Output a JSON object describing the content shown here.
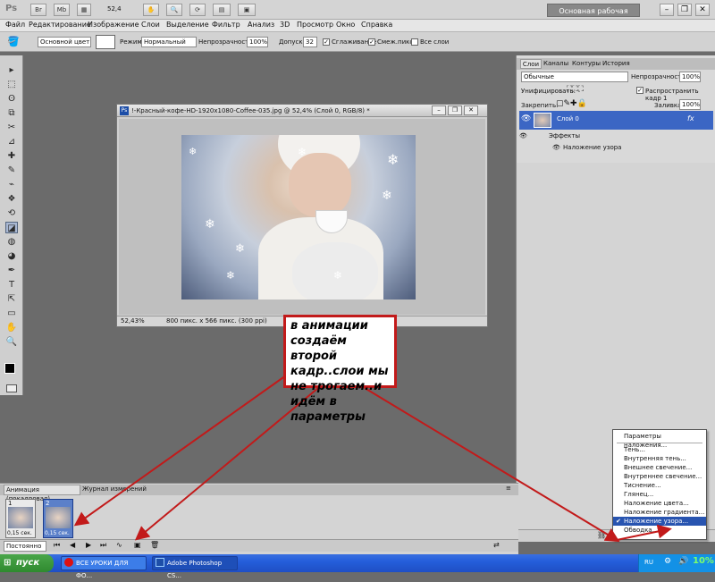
{
  "appbar": {
    "logo": "Ps",
    "br_label": "Br",
    "mb_label": "Mb",
    "zoom": "52,4",
    "workspace": "Основная рабочая среда",
    "minimize": "–",
    "restore": "❐",
    "close": "✕"
  },
  "menu": [
    "Файл",
    "Редактирование",
    "Изображение",
    "Слои",
    "Выделение",
    "Фильтр",
    "Анализ",
    "3D",
    "Просмотр",
    "Окно",
    "Справка"
  ],
  "options": {
    "fill_source": "Основной цвет",
    "mode_label": "Режим:",
    "mode_value": "Нормальный",
    "opacity_label": "Непрозрачность:",
    "opacity_value": "100%",
    "tolerance_label": "Допуск:",
    "tolerance_value": "32",
    "antialias_label": "Сглаживание",
    "contiguous_label": "Смеж.пикс",
    "alllayers_label": "Все слои"
  },
  "tools": [
    "▸",
    "⬚",
    "ʘ",
    "⧉",
    "✂",
    "⊿",
    "✚",
    "✎",
    "⌁",
    "❖",
    "⟲",
    "◪",
    "◍",
    "◕",
    "✒",
    "T",
    "⇱",
    "▭",
    "✋",
    "🔍"
  ],
  "document": {
    "title": "!-Красный-кофе-HD-1920x1080-Coffee-035.jpg @ 52,4% (Слой 0, RGB/8) *",
    "zoom": "52,43%",
    "info": "800 пикс. x 566 пикс. (300 ppi)"
  },
  "layers": {
    "tabs": [
      "Слои",
      "Каналы",
      "Контуры",
      "История"
    ],
    "blend_mode": "Обычные",
    "opacity_label": "Непрозрачность:",
    "opacity_value": "100%",
    "unify_label": "Унифицировать:",
    "propagate_label": "Распространить кадр 1",
    "lock_label": "Закрепить:",
    "fill_label": "Заливка:",
    "fill_value": "100%",
    "layer_name": "Слой 0",
    "fx_badge": "fx",
    "effects_label": "Эффекты",
    "effect_item": "Наложение узора"
  },
  "fxmenu": {
    "items": [
      "Параметры наложения...",
      "Тень...",
      "Внутренняя тень...",
      "Внешнее свечение...",
      "Внутреннее свечение...",
      "Тиснение...",
      "Глянец...",
      "Наложение цвета...",
      "Наложение градиента...",
      "Наложение узора...",
      "Обводка..."
    ],
    "selected": "Наложение узора...",
    "check": "✔"
  },
  "animation": {
    "tabs": [
      "Анимация (покадровая)",
      "Журнал измерений"
    ],
    "frames": [
      {
        "num": "1",
        "delay": "0,15 сек."
      },
      {
        "num": "2",
        "delay": "0,15 сек."
      }
    ],
    "loop": "Постоянно"
  },
  "callout": {
    "text": "в анимации создаём второй кадр..слои мы не трогаем..и идём в параметры"
  },
  "taskbar": {
    "start": "пуск",
    "tasks": [
      "ВСЕ УРОКИ ДЛЯ ФО...",
      "Adobe Photoshop CS..."
    ],
    "lang": "RU",
    "tray_text": "10%"
  },
  "colors": {
    "callout_border": "#c21a1a",
    "arrow": "#c21a1a",
    "selection": "#2854b0",
    "taskbar": "#245edb"
  }
}
